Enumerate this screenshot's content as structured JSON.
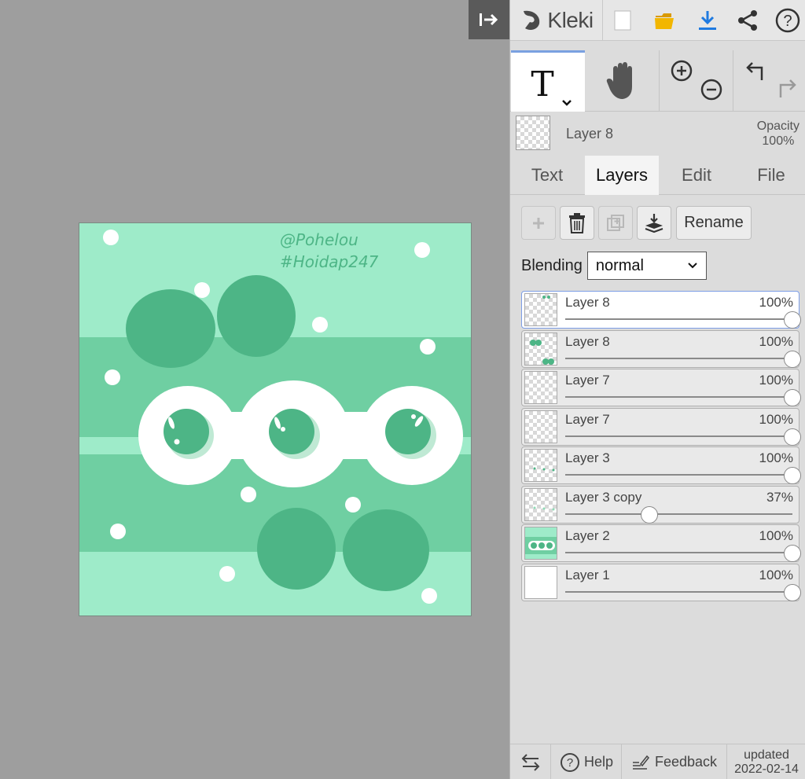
{
  "app": {
    "name": "Kleki"
  },
  "canvas": {
    "watermark_line1": "@Pohelou",
    "watermark_line2": "#Hoidap247",
    "colors": {
      "light": "#9eebc9",
      "mid": "#6fcfa2",
      "dark": "#4db586",
      "white": "#ffffff"
    }
  },
  "toolbar": {
    "icons": [
      "new-file-icon",
      "open-folder-icon",
      "download-icon",
      "share-icon",
      "help-icon"
    ],
    "accent": "#1f7ae0"
  },
  "tools": {
    "active": "text",
    "items": [
      "text-tool",
      "hand-tool",
      "zoom-tool",
      "undo-redo"
    ]
  },
  "current_layer": {
    "name": "Layer 8",
    "opacity_label": "Opacity",
    "opacity_value": "100%"
  },
  "tabs": [
    {
      "label": "Text",
      "active": false
    },
    {
      "label": "Layers",
      "active": true
    },
    {
      "label": "Edit",
      "active": false
    },
    {
      "label": "File",
      "active": false
    }
  ],
  "layer_actions": {
    "rename": "Rename"
  },
  "blending": {
    "label": "Blending",
    "value": "normal"
  },
  "layers": [
    {
      "name": "Layer 8",
      "opacity": "100%",
      "level": 1.0,
      "selected": true
    },
    {
      "name": "Layer 8",
      "opacity": "100%",
      "level": 1.0,
      "selected": false
    },
    {
      "name": "Layer 7",
      "opacity": "100%",
      "level": 1.0,
      "selected": false
    },
    {
      "name": "Layer 7",
      "opacity": "100%",
      "level": 1.0,
      "selected": false
    },
    {
      "name": "Layer 3",
      "opacity": "100%",
      "level": 1.0,
      "selected": false
    },
    {
      "name": "Layer 3 copy",
      "opacity": "37%",
      "level": 0.37,
      "selected": false
    },
    {
      "name": "Layer 2",
      "opacity": "100%",
      "level": 1.0,
      "selected": false
    },
    {
      "name": "Layer 1",
      "opacity": "100%",
      "level": 1.0,
      "selected": false
    }
  ],
  "footer": {
    "help": "Help",
    "feedback": "Feedback",
    "updated_label": "updated",
    "updated_date": "2022-02-14"
  }
}
